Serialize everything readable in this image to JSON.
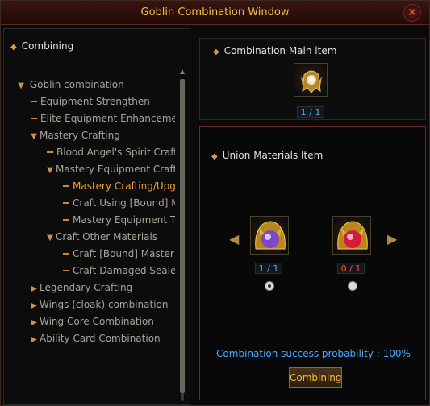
{
  "window": {
    "title": "Goblin Combination Window",
    "close_label": "✕"
  },
  "left_panel": {
    "header": "Combining",
    "tree": [
      {
        "label": "Goblin combination",
        "level": 0,
        "icon": "triangle-down-icon"
      },
      {
        "label": "Equipment Strengthen",
        "level": 1,
        "icon": "dash-icon"
      },
      {
        "label": "Elite Equipment Enhancemer",
        "level": 1,
        "icon": "dash-icon"
      },
      {
        "label": "Mastery Crafting",
        "level": 1,
        "icon": "triangle-down-icon"
      },
      {
        "label": "Blood Angel's Spirit Craft",
        "level": 2,
        "icon": "dash-icon"
      },
      {
        "label": "Mastery Equipment Craft",
        "level": 2,
        "icon": "triangle-down-icon"
      },
      {
        "label": "Mastery Crafting/Upg",
        "level": 3,
        "icon": "dash-icon",
        "selected": true
      },
      {
        "label": "Craft Using [Bound] M",
        "level": 3,
        "icon": "dash-icon"
      },
      {
        "label": "Mastery Equipment T",
        "level": 3,
        "icon": "dash-icon"
      },
      {
        "label": "Craft Other Materials",
        "level": 2,
        "icon": "triangle-down-icon"
      },
      {
        "label": "Craft [Bound] Master",
        "level": 3,
        "icon": "dash-icon"
      },
      {
        "label": "Craft Damaged Seale",
        "level": 3,
        "icon": "dash-icon"
      },
      {
        "label": "Legendary Crafting",
        "level": 1,
        "icon": "triangle-right-icon"
      },
      {
        "label": "Wings (cloak) combination",
        "level": 1,
        "icon": "triangle-right-icon"
      },
      {
        "label": "Wing Core Combination",
        "level": 1,
        "icon": "triangle-right-icon"
      },
      {
        "label": "Ability Card Combination",
        "level": 1,
        "icon": "triangle-right-icon"
      }
    ]
  },
  "main_item": {
    "header": "Combination Main item",
    "count": "1 / 1"
  },
  "union": {
    "header": "Union Materials Item",
    "materials": [
      {
        "count": "1 / 1",
        "count_color": "#4aa8ff",
        "checked": true
      },
      {
        "count": "0 / 1",
        "count_color": "#ff4a3a",
        "checked": false
      }
    ],
    "probability": "Combination success probability : 100%",
    "combine_label": "Combining"
  }
}
